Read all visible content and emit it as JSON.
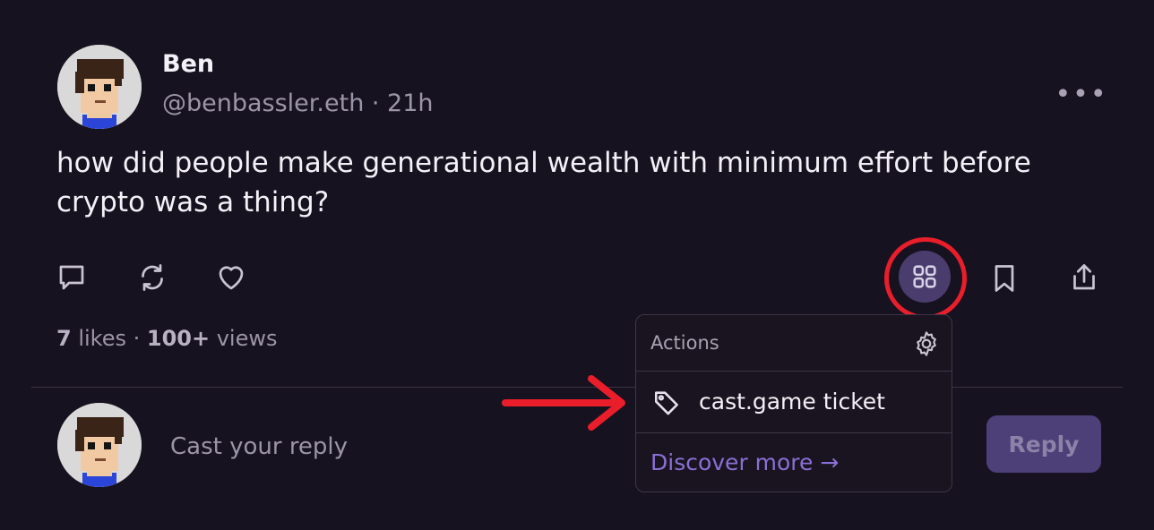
{
  "post": {
    "author_name": "Ben",
    "author_meta": "@benbassler.eth · 21h",
    "more_label": "•••",
    "text": "how did people make generational wealth with minimum effort before crypto was a thing?",
    "likes_count": "7",
    "likes_label": " likes",
    "stats_separator": " · ",
    "views_count": "100+",
    "views_label": " views"
  },
  "icons": {
    "reply": "comment-icon",
    "recast": "recast-icon",
    "like": "heart-icon",
    "actions": "grid-icon",
    "bookmark": "bookmark-icon",
    "share": "share-icon",
    "settings": "gear-icon",
    "ticket": "tag-icon"
  },
  "actions_menu": {
    "title": "Actions",
    "item_label": "cast.game ticket",
    "discover_label": "Discover more →"
  },
  "reply_box": {
    "placeholder": "Cast your reply",
    "button_label": "Reply"
  },
  "colors": {
    "background": "#17121f",
    "accent": "#8b6fd6",
    "highlight": "#ea1e2a",
    "reply_button": "#4d3f78"
  }
}
